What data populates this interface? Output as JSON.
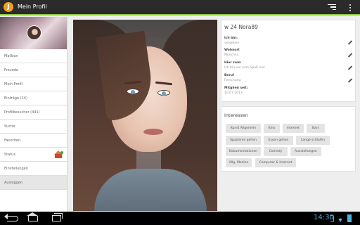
{
  "app": {
    "logo_letter": "J",
    "title": "Mein Profil"
  },
  "actionbar": {
    "filter_icon": "filter-icon",
    "overflow_icon": "overflow-menu-icon",
    "accent_color": "#8cc63f"
  },
  "sidebar": {
    "items": [
      {
        "label": "Mailbox"
      },
      {
        "label": "Freunde"
      },
      {
        "label": "Mein Profil",
        "active": false
      },
      {
        "label": "Einträge (14)"
      },
      {
        "label": "Profilbesucher (441)"
      },
      {
        "label": "Suche"
      },
      {
        "label": "Favoriten"
      },
      {
        "label": "Status"
      },
      {
        "label": "Einstellungen"
      },
      {
        "label": "Ausloggen",
        "active": true
      }
    ]
  },
  "profile": {
    "title": "w 24 Nora89",
    "fields": [
      {
        "label": "Ich bin:",
        "value": "vergeben"
      },
      {
        "label": "Wohnort",
        "value": "München"
      },
      {
        "label": "Hier zum:",
        "value": "Ich bin nur zum Spaß hier"
      },
      {
        "label": "Beruf",
        "value": "Forschung"
      },
      {
        "label": "Mitglied seit:",
        "value": "10.07.2013"
      }
    ]
  },
  "interests": {
    "title": "Interessen",
    "chips": [
      "Kunst Allgemein",
      "Kino",
      "Internet",
      "Bars",
      "Spazieren gehen",
      "Essen gehen",
      "Lange schlafen",
      "Dokumentationen",
      "Comedy",
      "Ausstellungen",
      "Allg. Medien",
      "Computer & Internet"
    ]
  },
  "statusbar": {
    "time": "14:30"
  }
}
